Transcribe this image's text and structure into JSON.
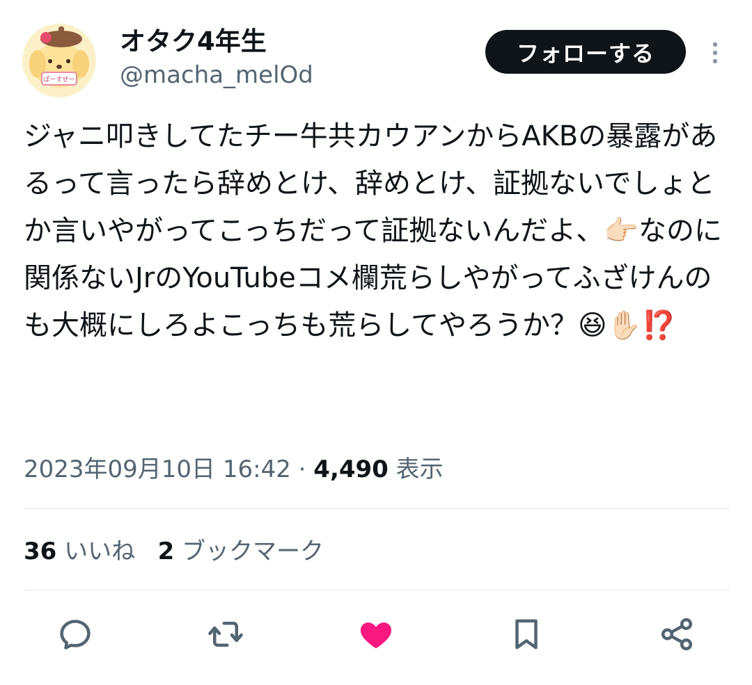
{
  "user": {
    "display_name": "オタク4年生",
    "handle": "@macha_melOd",
    "avatar_badge_text": "ぽーすぜー"
  },
  "follow_label": "フォローする",
  "tweet": {
    "text": "ジャニ叩きしてたチー牛共カウアンからAKBの暴露があるって言ったら辞めとけ、辞めとけ、証拠ないでしょとか言いやがってこっちだって証拠ないんだよ、👉🏻なのに関係ないJrのYouTubeコメ欄荒らしやがってふざけんのも大概にしろよこっちも荒らしてやろうか？😆✋🏻⁉️"
  },
  "meta": {
    "timestamp": "2023年09月10日 16:42",
    "separator": " · ",
    "views_count": "4,490",
    "views_label": "表示"
  },
  "stats": {
    "likes_count": "36",
    "likes_label": "いいね",
    "bookmarks_count": "2",
    "bookmarks_label": "ブックマーク"
  },
  "actions": [
    "reply-icon",
    "retweet-icon",
    "like-icon",
    "bookmark-icon",
    "share-icon"
  ],
  "colors": {
    "text": "#0f1419",
    "muted": "#536471",
    "like": "#f91880",
    "follow_bg": "#0f1419"
  }
}
